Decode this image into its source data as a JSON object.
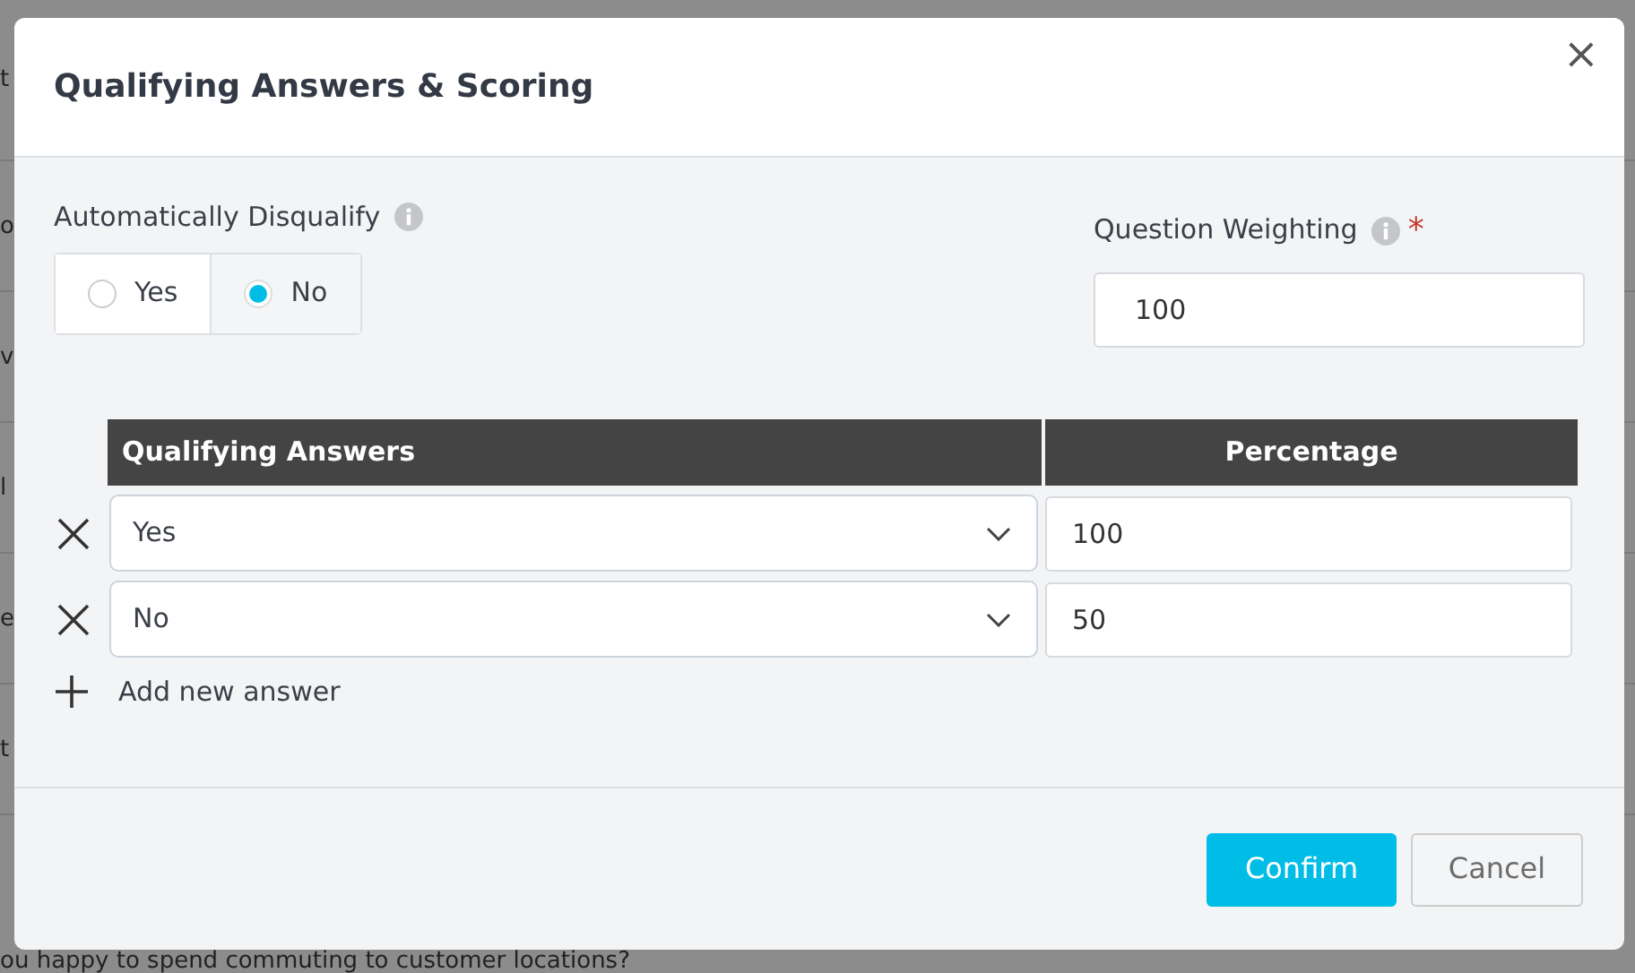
{
  "background": {
    "row_fragments": [
      "t",
      "o",
      "v",
      "l",
      "e",
      "t"
    ],
    "bottom_text": "ou happy to spend commuting to customer locations?"
  },
  "dialog": {
    "title": "Qualifying Answers & Scoring",
    "close": "×",
    "disqualify": {
      "label": "Automatically Disqualify",
      "options": [
        {
          "label": "Yes",
          "selected": false
        },
        {
          "label": "No",
          "selected": true
        }
      ]
    },
    "weighting": {
      "label": "Question Weighting",
      "required": "*",
      "value": "100"
    },
    "table": {
      "columns": [
        "Qualifying Answers",
        "Percentage"
      ],
      "rows": [
        {
          "answer": "Yes",
          "percentage": "100"
        },
        {
          "answer": "No",
          "percentage": "50"
        }
      ]
    },
    "add_answer": "Add new answer",
    "buttons": [
      {
        "label": "Confirm",
        "kind": "primary"
      },
      {
        "label": "Cancel",
        "kind": "secondary"
      }
    ]
  }
}
